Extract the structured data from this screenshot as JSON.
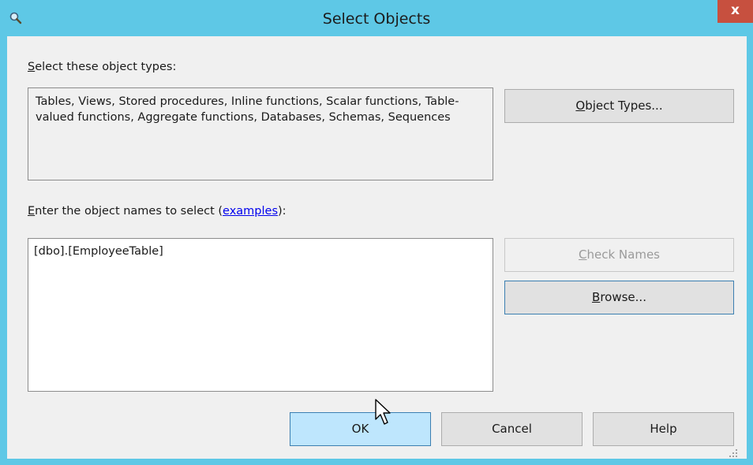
{
  "window": {
    "title": "Select Objects",
    "close_label": "x",
    "title_icon": "magnifier-icon"
  },
  "object_types": {
    "label_prefix": "",
    "label_underlined": "S",
    "label_rest": "elect these object types:",
    "value": "Tables, Views, Stored procedures, Inline functions, Scalar functions, Table-valued functions, Aggregate functions, Databases, Schemas, Sequences",
    "button_underlined": "O",
    "button_rest": "bject Types..."
  },
  "object_names": {
    "label_underlined": "E",
    "label_rest": "nter the object names to select (",
    "link_text": "examples",
    "label_end": "):",
    "value": "[dbo].[EmployeeTable]"
  },
  "buttons": {
    "check_names_underlined": "C",
    "check_names_rest": "heck Names",
    "browse_underlined": "B",
    "browse_rest": "rowse...",
    "ok": "OK",
    "cancel": "Cancel",
    "help": "Help"
  },
  "colors": {
    "titlebar": "#5ec8e6",
    "close": "#c7503f",
    "link": "#0000ee"
  }
}
